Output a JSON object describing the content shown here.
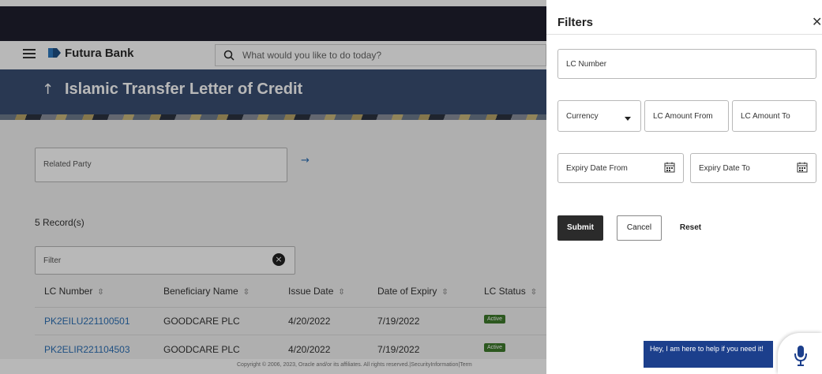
{
  "app": {
    "brand": "Futura Bank",
    "search_placeholder": "What would you like to do today?"
  },
  "page": {
    "back_icon": "up-arrow-icon",
    "title": "Islamic Transfer Letter of Credit",
    "related_party_label": "Related Party",
    "records_count": "5 Record(s)",
    "filter_placeholder": "Filter"
  },
  "table": {
    "headers": [
      "LC Number",
      "Beneficiary Name",
      "Issue Date",
      "Date of Expiry",
      "LC Status"
    ],
    "rows": [
      {
        "lc_number": "PK2EILU221100501",
        "beneficiary": "GOODCARE PLC",
        "issue_date": "4/20/2022",
        "expiry": "7/19/2022",
        "status": "Active"
      },
      {
        "lc_number": "PK2ELIR221104503",
        "beneficiary": "GOODCARE PLC",
        "issue_date": "4/20/2022",
        "expiry": "7/19/2022",
        "status": "Active"
      }
    ]
  },
  "footer": {
    "text": "Copyright © 2006, 2023, Oracle and/or its affiliates. All rights reserved.|SecurityInformation|Term"
  },
  "filters": {
    "title": "Filters",
    "lc_number_label": "LC Number",
    "currency_label": "Currency",
    "lc_amount_from_label": "LC Amount From",
    "lc_amount_to_label": "LC Amount To",
    "expiry_date_from_label": "Expiry Date From",
    "expiry_date_to_label": "Expiry Date To",
    "submit_label": "Submit",
    "cancel_label": "Cancel",
    "reset_label": "Reset"
  },
  "chatbot": {
    "message": "Hey, I am here to help if you need it!"
  },
  "colors": {
    "banner": "#3a4e72",
    "link": "#2b6fb5",
    "active_badge": "#3d7a2b",
    "chat_bubble": "#1c3f8c"
  }
}
